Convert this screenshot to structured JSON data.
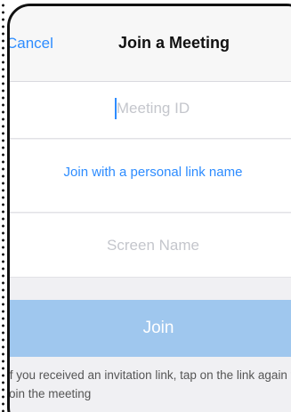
{
  "navbar": {
    "cancel_label": "Cancel",
    "title": "Join a Meeting"
  },
  "meeting_id": {
    "value": "",
    "placeholder": "Meeting ID"
  },
  "personal_link": {
    "label": "Join with a personal link name"
  },
  "screen_name": {
    "value": "",
    "placeholder": "Screen Name"
  },
  "join_button": {
    "label": "Join",
    "enabled": false
  },
  "help_text": {
    "line1": "If you received an invitation link, tap on the link again to",
    "line2": "join the meeting"
  },
  "colors": {
    "accent": "#2d8cff",
    "join_disabled": "#9fc7ee",
    "placeholder": "#c4c6cc",
    "background": "#f0f0f3"
  }
}
